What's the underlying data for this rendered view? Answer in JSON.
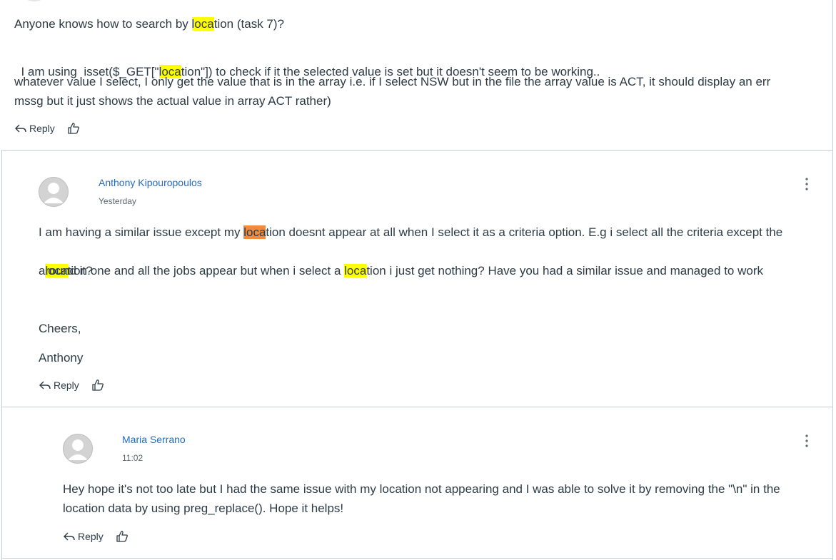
{
  "post1": {
    "line1": {
      "pre": "Anyone knows how to search by ",
      "hl": "loca",
      "post": "tion (task 7)?"
    },
    "line2": {
      "pre": "I am using  isset($_GET[\"",
      "hl": "loca",
      "post": "tion\"]) to check if it the selected value is set but it doesn't seem to be working.."
    },
    "line3a": "whatever value I select, I only get the value that is in the array i.e. if I select NSW but in the file the array value is ACT, it should display an err",
    "line3b": "mssg but it just shows the actual value in array ACT rather)",
    "reply_label": "Reply"
  },
  "post2": {
    "author": "Anthony Kipouropoulos",
    "time": "Yesterday",
    "l1_pre": "I am having a similar issue except my ",
    "l1_hl": "loca",
    "l1_post": "tion doesnt appear at all when I select it as a criteria option. E.g i select all the criteria except the",
    "l2_hl1": "loca",
    "l2_mid": "tion one and all the jobs appear but when i select a ",
    "l2_hl2": "loca",
    "l2_post": "tion i just get nothing? Have you had a similar issue and managed to work",
    "l3": "around it?",
    "cheers": "Cheers,",
    "sign": "Anthony",
    "reply_label": "Reply"
  },
  "post3": {
    "author": "Maria Serrano",
    "time": "11:02",
    "l1": "Hey hope it's not too late but I had the same issue with my location not appearing and I was able to solve it by removing the \"\\n\" in the",
    "l2": "location data by using preg_replace(). Hope it helps!",
    "reply_label": "Reply"
  },
  "icons": [
    "reply-arrow-icon",
    "like-icon",
    "avatar-icon",
    "more-options-icon"
  ],
  "colors": {
    "link": "#2b6cb0",
    "highlight": "#ffff00",
    "active_highlight": "#f08a3c",
    "text": "#2d3b45"
  }
}
